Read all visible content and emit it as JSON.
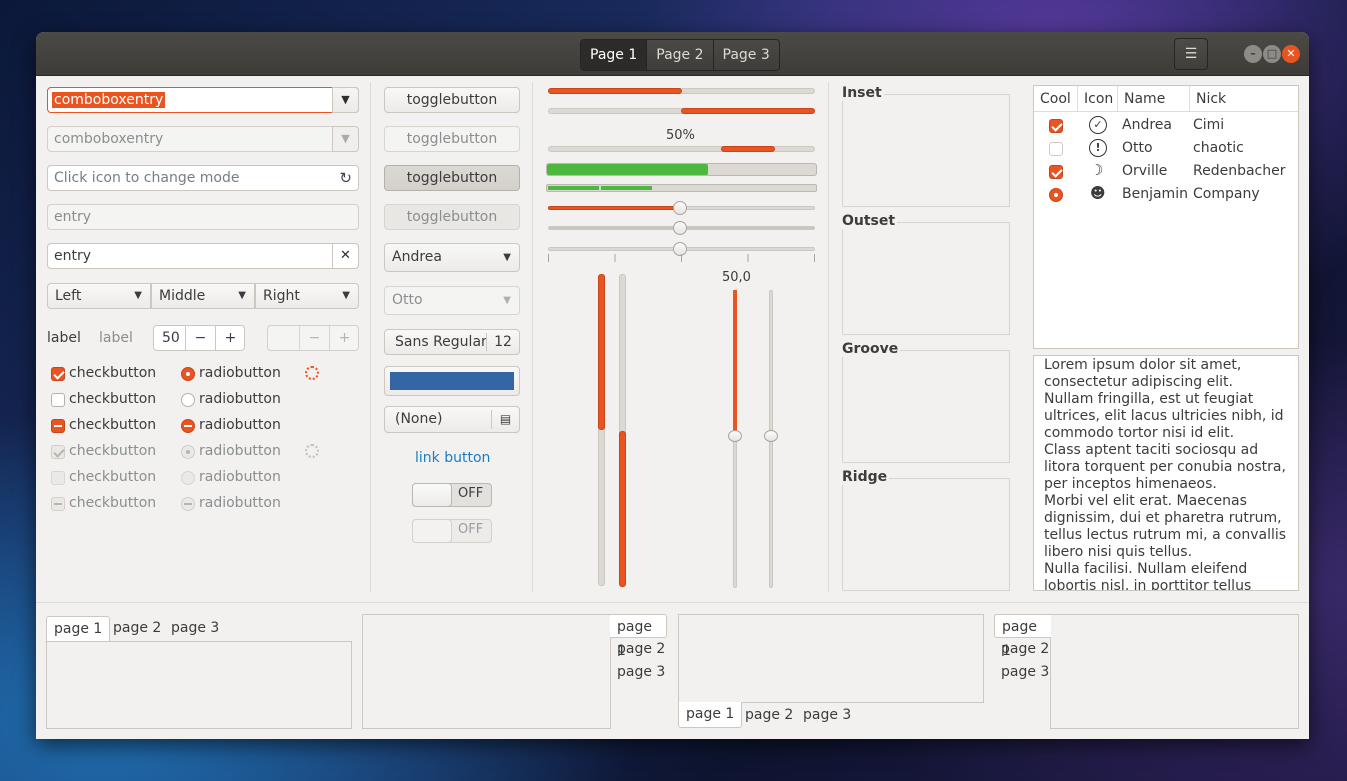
{
  "titlebar": {
    "stack_tabs": [
      "Page 1",
      "Page 2",
      "Page 3"
    ],
    "menu_icon": "hamburger-menu-icon",
    "window_buttons": [
      "minimize",
      "maximize",
      "close"
    ]
  },
  "col1": {
    "combo_entry": "comboboxentry",
    "combo_entry_disabled": "comboboxentry",
    "mode_entry_placeholder": "Click icon to change mode",
    "entry_disabled": "entry",
    "entry": "entry",
    "segmented": [
      "Left",
      "Middle",
      "Right"
    ],
    "label1": "label",
    "label2": "label",
    "spin_value": "50",
    "spin_minus": "−",
    "spin_plus": "+",
    "check_label": "checkbutton",
    "radio_label": "radiobutton"
  },
  "col2": {
    "toggle": "togglebutton",
    "combo_selected": "Andrea",
    "combo_disabled": "Otto",
    "font_name": "Sans Regular",
    "font_size": "12",
    "color_hex": "#3465a4",
    "file_chooser": "(None)",
    "link": "link button",
    "switch_off": "OFF"
  },
  "col3": {
    "progress_label": "50%",
    "vscale_value": "50,0",
    "progress_green": 0.6,
    "scale_value": 0.5
  },
  "frames": {
    "inset": "Inset",
    "outset": "Outset",
    "groove": "Groove",
    "ridge": "Ridge"
  },
  "tree": {
    "headers": [
      "Cool",
      "Icon",
      "Name",
      "Nick"
    ],
    "rows": [
      {
        "name": "Andrea",
        "nick": "Cimi",
        "icon": "check-circle-icon"
      },
      {
        "name": "Otto",
        "nick": "chaotic",
        "icon": "exclamation-circle-icon"
      },
      {
        "name": "Orville",
        "nick": "Redenbacher",
        "icon": "moon-icon"
      },
      {
        "name": "Benjamin",
        "nick": "Company",
        "icon": "face-icon"
      }
    ]
  },
  "textview": {
    "text": "Lorem ipsum dolor sit amet, consectetur adipiscing elit.\nNullam fringilla, est ut feugiat ultrices, elit lacus ultricies nibh, id commodo tortor nisi id elit.\nClass aptent taciti sociosqu ad litora torquent per conubia nostra, per inceptos himenaeos.\nMorbi vel elit erat. Maecenas dignissim, dui et pharetra rutrum, tellus lectus rutrum mi, a convallis libero nisi quis tellus.\nNulla facilisi. Nullam eleifend lobortis nisl, in porttitor tellus"
  },
  "notebooks": {
    "tabs": [
      "page 1",
      "page 2",
      "page 3"
    ]
  },
  "colors": {
    "accent": "#e95420",
    "green": "#4cb83f",
    "window_bg": "#f2f1ef",
    "titlebar": "#403f3b",
    "link": "#1a7dc4",
    "close": "#e95420"
  }
}
